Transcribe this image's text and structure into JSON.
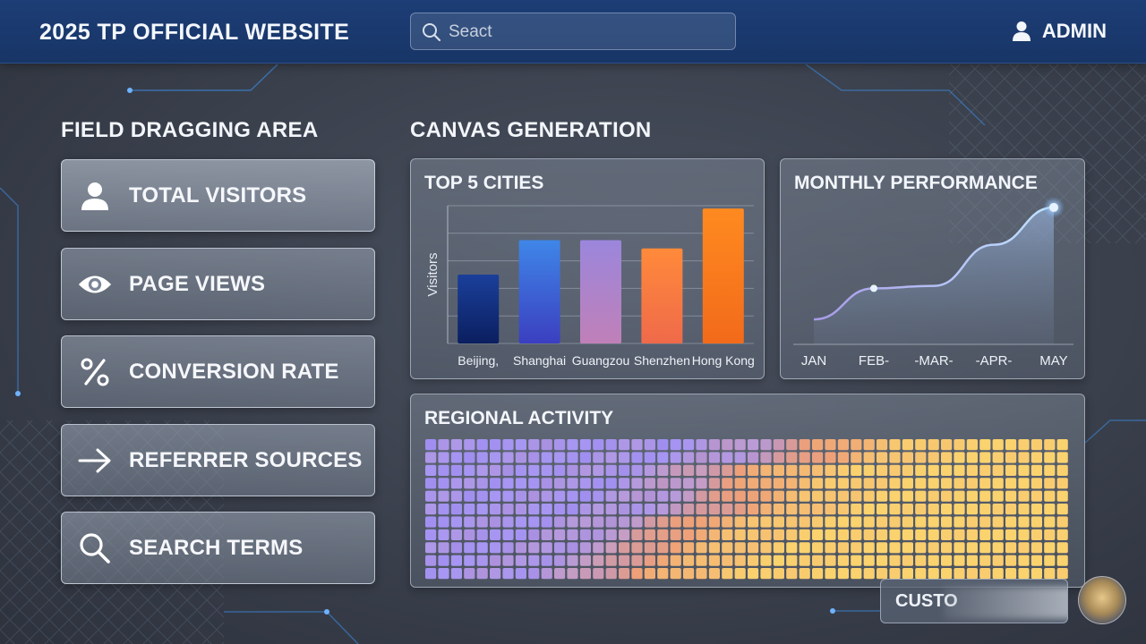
{
  "header": {
    "title": "2025 TP OFFICIAL WEBSITE",
    "search_placeholder": "Seact",
    "user_label": "ADMIN"
  },
  "sidebar": {
    "title": "FIELD DRAGGING AREA",
    "fields": [
      {
        "label": "TOTAL VISITORS",
        "icon": "user-icon"
      },
      {
        "label": "PAGE VIEWS",
        "icon": "eye-icon"
      },
      {
        "label": "CONVERSION RATE",
        "icon": "percent-icon"
      },
      {
        "label": "REFERRER SOURCES",
        "icon": "arrow-right-icon"
      },
      {
        "label": "SEARCH TERMS",
        "icon": "search-icon"
      }
    ]
  },
  "canvas": {
    "title": "CANVAS GENERATION",
    "custom_button_label": "CUSTO"
  },
  "colors": {
    "header_bg": "#1b3a70",
    "bar_beijing": "#1a3f9a",
    "bar_shanghai": "#3f6ee0",
    "bar_guangzou": "#a07fd0",
    "bar_shenzhen": "#f07a3e",
    "bar_hongkong": "#fa7a20",
    "heat_low": "#9b8cf2",
    "heat_high": "#f9d067"
  },
  "chart_data": [
    {
      "type": "bar",
      "title": "TOP 5 CITIES",
      "ylabel": "Visitors",
      "xlabel": "",
      "categories": [
        "Beijing,",
        "Shanghai",
        "Guangzou",
        "Shenzhen",
        "Hong Kong"
      ],
      "values": [
        50,
        75,
        75,
        69,
        98
      ],
      "ylim": [
        0,
        100
      ],
      "grid": true
    },
    {
      "type": "area",
      "title": "MONTHLY PERFORMANCE",
      "categories": [
        "JAN",
        "FEB-",
        "-MAR-",
        "-APR-",
        "MAY"
      ],
      "values": [
        20,
        45,
        47,
        80,
        110
      ],
      "ylim": [
        0,
        120
      ],
      "highlighted_points": [
        "FEB-",
        "MAY"
      ]
    },
    {
      "type": "heatmap",
      "title": "REGIONAL ACTIVITY",
      "rows": 11,
      "cols": 50
    }
  ]
}
